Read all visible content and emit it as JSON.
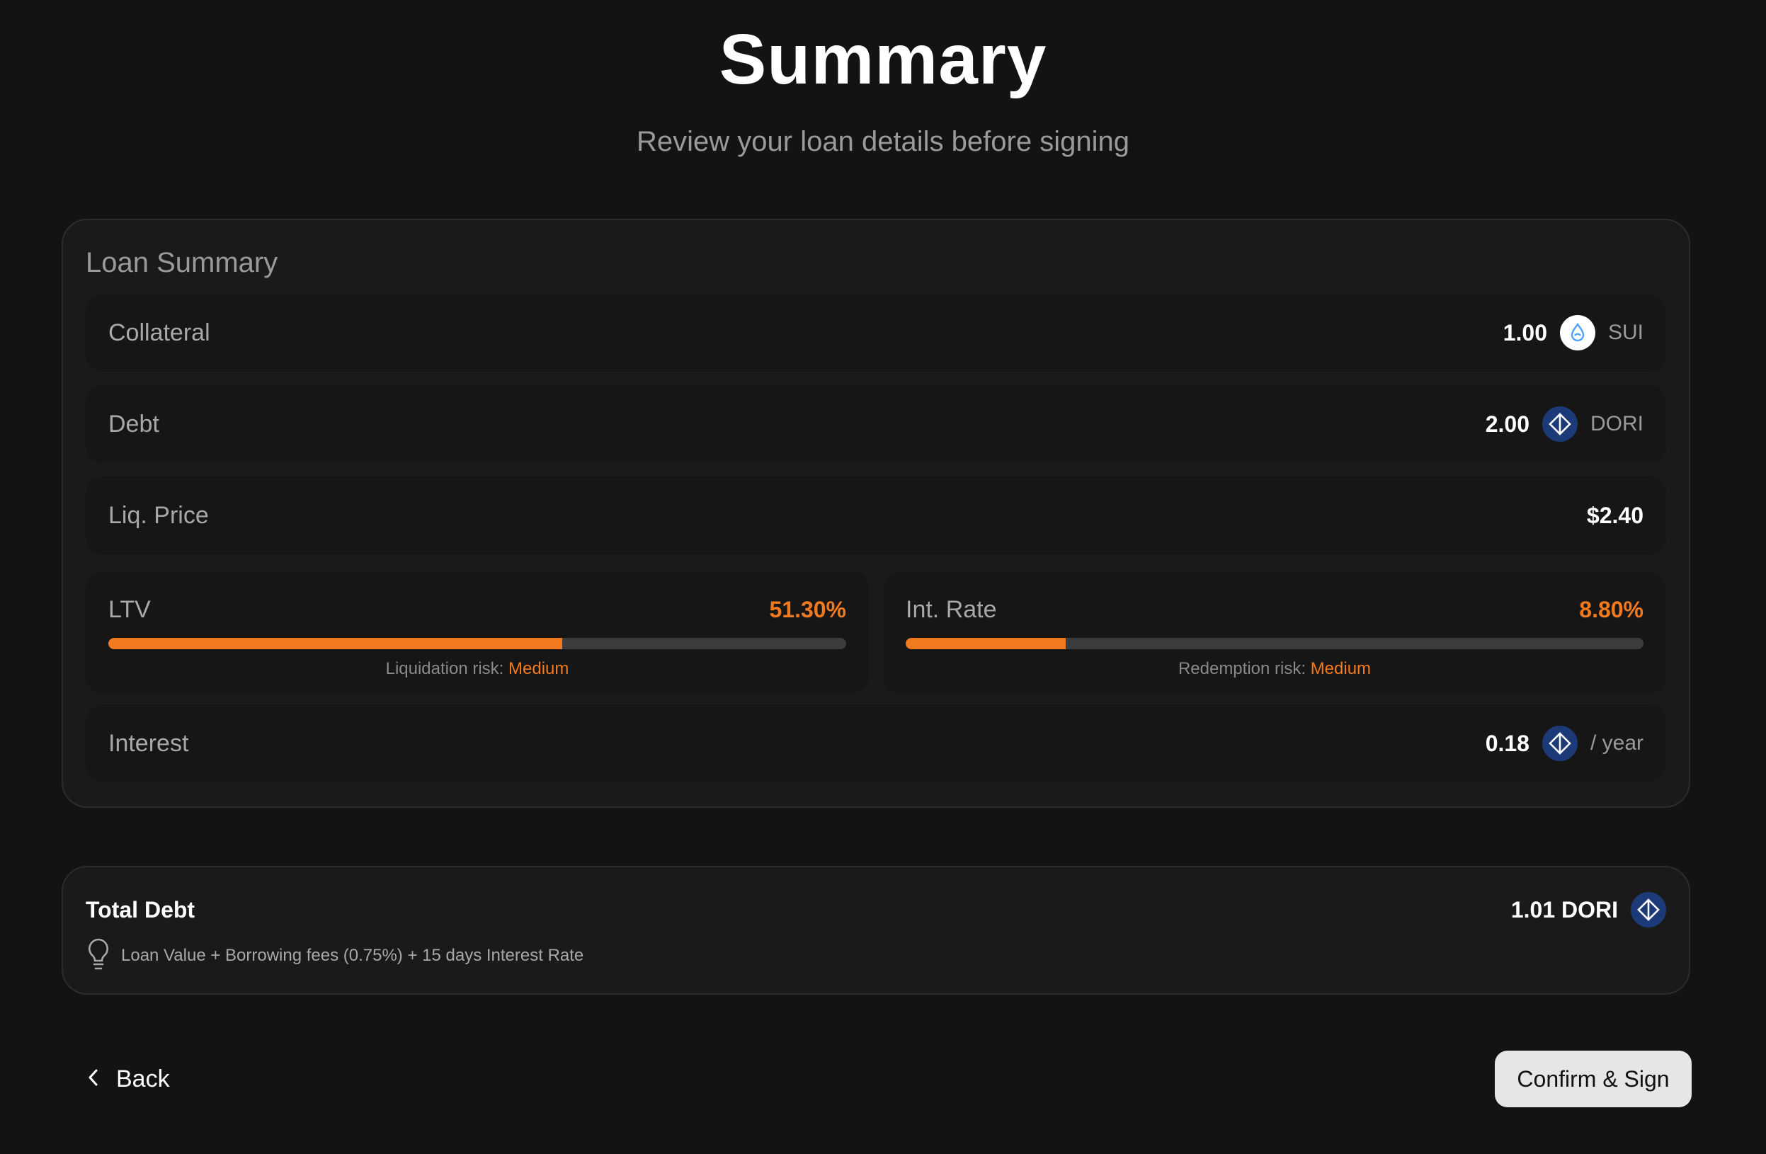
{
  "header": {
    "title": "Summary",
    "subtitle": "Review your loan details before signing"
  },
  "loan_summary": {
    "title": "Loan Summary",
    "collateral": {
      "label": "Collateral",
      "amount": "1.00",
      "token": "SUI",
      "icon": "sui-drop-icon"
    },
    "debt": {
      "label": "Debt",
      "amount": "2.00",
      "token": "DORI",
      "icon": "dori-token-icon"
    },
    "liq_price": {
      "label": "Liq. Price",
      "value": "$2.40"
    },
    "ltv": {
      "label": "LTV",
      "value": "51.30%",
      "fill_percent": 61.5,
      "risk_label": "Liquidation risk:",
      "risk_level": "Medium"
    },
    "int_rate": {
      "label": "Int. Rate",
      "value": "8.80%",
      "fill_percent": 21.7,
      "risk_label": "Redemption risk:",
      "risk_level": "Medium"
    },
    "interest": {
      "label": "Interest",
      "amount": "0.18",
      "unit": "/ year",
      "icon": "dori-token-icon"
    }
  },
  "total_debt": {
    "label": "Total Debt",
    "value": "1.01 DORI",
    "icon": "dori-token-icon",
    "note": "Loan Value + Borrowing fees (0.75%) + 15 days Interest Rate",
    "note_icon": "lightbulb-icon"
  },
  "actions": {
    "back_label": "Back",
    "confirm_label": "Confirm & Sign"
  },
  "colors": {
    "background": "#131313",
    "card": "#1a1a1a",
    "accent": "#f27a1e",
    "dori_blue": "#1d3a78"
  }
}
